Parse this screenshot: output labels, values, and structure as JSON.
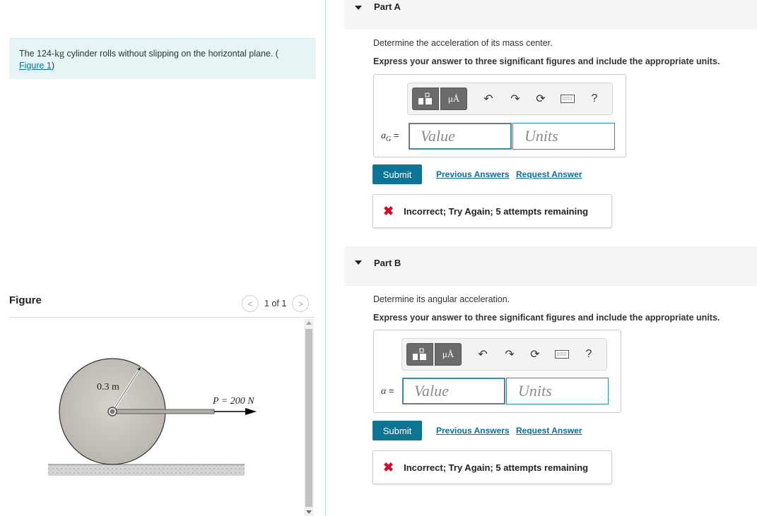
{
  "problem": {
    "text_before": "The 124-",
    "kg": "kg",
    "text_after": " cylinder rolls without slipping on the horizontal plane. (",
    "figure_link": "Figure 1",
    "close_paren": ")"
  },
  "figure": {
    "title": "Figure",
    "counter": "1 of 1",
    "prev": "<",
    "next": ">",
    "radius_label": "0.3 m",
    "force_label": "P = 200 N"
  },
  "parts": [
    {
      "title": "Part A",
      "question": "Determine the acceleration of its mass center.",
      "instruction": "Express your answer to three significant figures and include the appropriate units.",
      "var_symbol": "a",
      "var_sub": "G",
      "eq": " =",
      "value_placeholder": "Value",
      "units_placeholder": "Units",
      "submit": "Submit",
      "previous_answers": "Previous Answers",
      "request_answer": "Request Answer",
      "feedback": "Incorrect; Try Again; 5 attempts remaining"
    },
    {
      "title": "Part B",
      "question": "Determine its angular acceleration.",
      "instruction": "Express your answer to three significant figures and include the appropriate units.",
      "var_symbol": "α",
      "var_sub": "",
      "eq": " =",
      "value_placeholder": "Value",
      "units_placeholder": "Units",
      "submit": "Submit",
      "previous_answers": "Previous Answers",
      "request_answer": "Request Answer",
      "feedback": "Incorrect; Try Again; 5 attempts remaining"
    }
  ],
  "toolbar": {
    "units_btn": "μÅ",
    "help": "?"
  },
  "colors": {
    "accent": "#0e7494",
    "error": "#c8102e",
    "problem_bg": "#e6f4f5"
  }
}
